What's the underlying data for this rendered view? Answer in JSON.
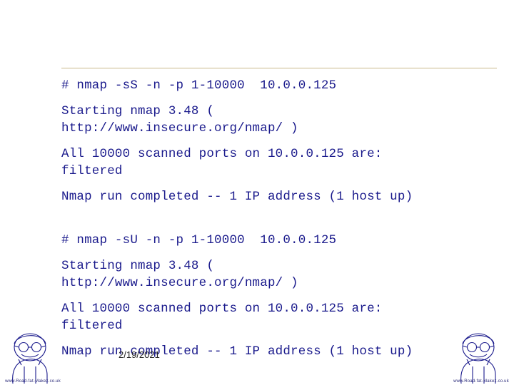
{
  "slide": {
    "date_stamp": "2/19/2021",
    "terminal_blocks": [
      {
        "lines": [
          "# nmap -sS -n -p 1-10000  10.0.0.125"
        ]
      },
      {
        "lines": [
          "Starting nmap 3.48 (",
          "http://www.insecure.org/nmap/ )"
        ]
      },
      {
        "lines": [
          "All 10000 scanned ports on 10.0.0.125 are:",
          "filtered"
        ]
      },
      {
        "lines": [
          "Nmap run completed -- 1 IP address (1 host up)"
        ]
      },
      {
        "lines": [
          "# nmap -sU -n -p 1-10000  10.0.0.125"
        ]
      },
      {
        "lines": [
          "Starting nmap 3.48 (",
          "http://www.insecure.org/nmap/ )"
        ]
      },
      {
        "lines": [
          "All 10000 scanned ports on 10.0.0.125 are:",
          "filtered"
        ]
      },
      {
        "lines": [
          "Nmap run completed -- 1 IP address (1 host up)"
        ]
      }
    ],
    "corner_graphics": {
      "left_caption": "www.Road-fat-Makez.co.uk",
      "right_caption": "www.Road-fat-Makez.co.uk"
    },
    "colors": {
      "text": "#1a1a8c",
      "rule": "#c9b98a",
      "date": "#222222"
    }
  }
}
